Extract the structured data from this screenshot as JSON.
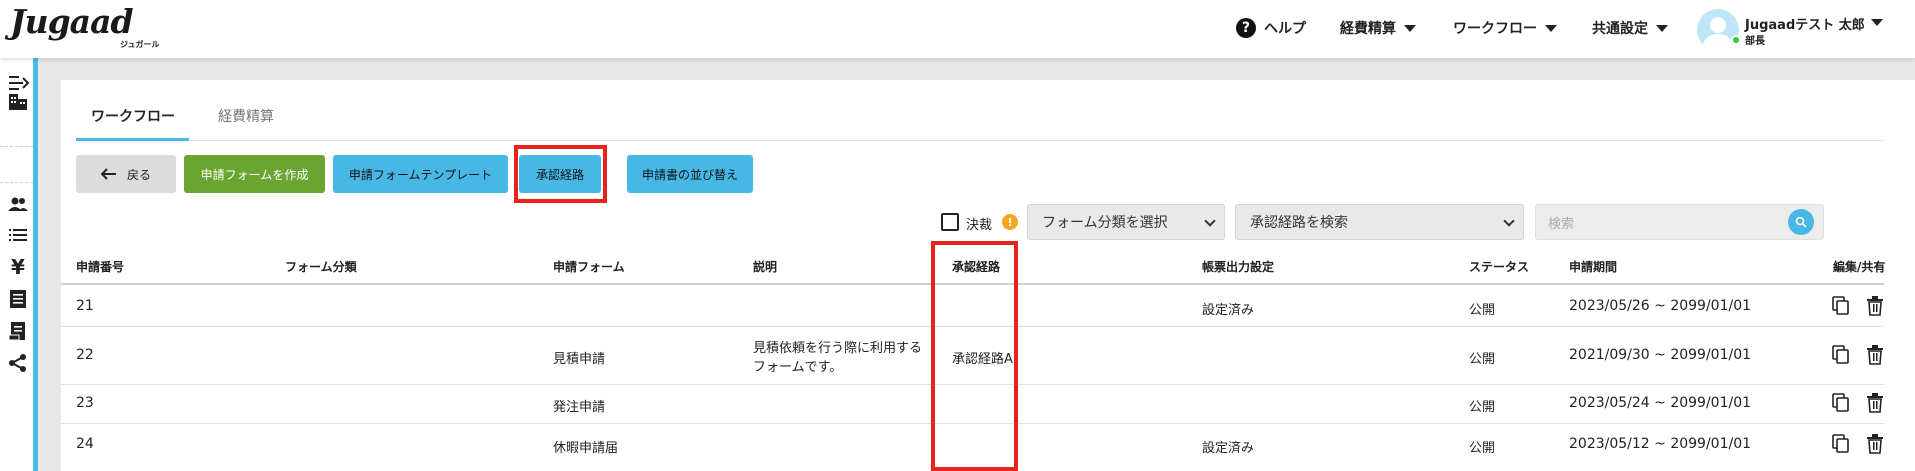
{
  "brand": {
    "logo": "Jugaad",
    "logo_sub": "ジュガール"
  },
  "nav": {
    "help": "ヘルプ",
    "items": [
      "経費精算",
      "ワークフロー",
      "共通設定"
    ]
  },
  "user": {
    "name": "Jugaadテスト 太郎",
    "role": "部長",
    "status_color": "#2ecc40"
  },
  "sidebar": {
    "icons": [
      "collapse-menu-icon",
      "building-icon",
      "users-icon",
      "list-icon",
      "yen-icon",
      "receipt-icon",
      "document-icon",
      "share-icon"
    ]
  },
  "tabs": [
    {
      "label": "ワークフロー",
      "active": true
    },
    {
      "label": "経費精算",
      "active": false
    }
  ],
  "toolbar": {
    "back": "戻る",
    "create_form": "申請フォームを作成",
    "form_template": "申請フォームテンプレート",
    "approval_route": "承認経路",
    "reorder": "申請書の並び替え"
  },
  "filters": {
    "approved_label": "決裁",
    "form_category_select": "フォーム分類を選択",
    "route_search_select": "承認経路を検索",
    "search_placeholder": "検索"
  },
  "table": {
    "headers": [
      "申請番号",
      "フォーム分類",
      "申請フォーム",
      "説明",
      "承認経路",
      "帳票出力設定",
      "ステータス",
      "申請期間",
      "編集/共有"
    ],
    "rows": [
      {
        "id": "21",
        "category": "",
        "form": "",
        "description": [
          "",
          ""
        ],
        "route": "",
        "output": "設定済み",
        "status": "公開",
        "period": "2023/05/26 ~ 2099/01/01"
      },
      {
        "id": "22",
        "category": "",
        "form": "見積申請",
        "description": [
          "見積依頼を行う際に利用する",
          "フォームです。"
        ],
        "route": "承認経路A",
        "output": "",
        "status": "公開",
        "period": "2021/09/30 ~ 2099/01/01"
      },
      {
        "id": "23",
        "category": "",
        "form": "発注申請",
        "description": [
          "",
          ""
        ],
        "route": "",
        "output": "",
        "status": "公開",
        "period": "2023/05/24 ~ 2099/01/01"
      },
      {
        "id": "24",
        "category": "",
        "form": "休暇申請届",
        "description": [
          "",
          ""
        ],
        "route": "",
        "output": "設定済み",
        "status": "公開",
        "period": "2023/05/12 ~ 2099/01/01"
      }
    ]
  },
  "colors": {
    "accent": "#47b7e6",
    "primary_green": "#6aa532",
    "highlight": "#e8231d"
  }
}
